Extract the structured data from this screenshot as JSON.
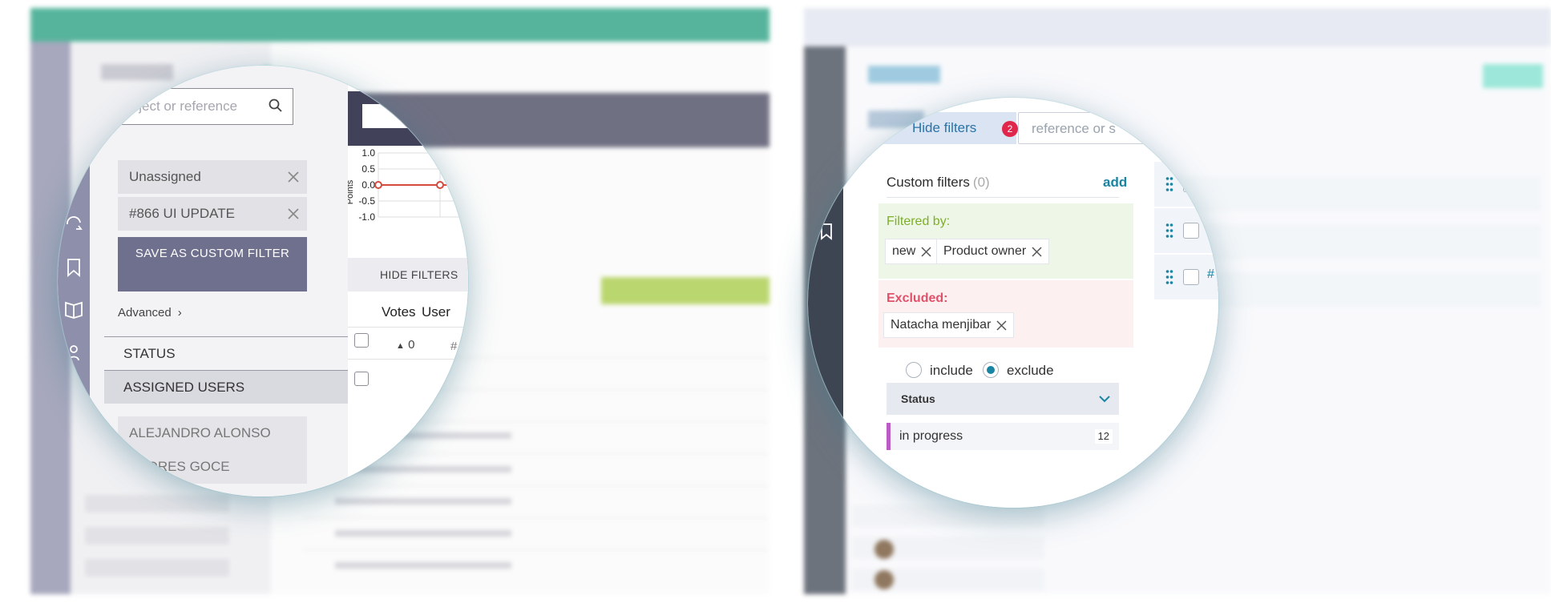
{
  "left_view": {
    "filters": {
      "search_placeholder": "Subject or reference",
      "applied": [
        "Unassigned",
        "#866 UI UPDATE"
      ],
      "save_button": "SAVE AS CUSTOM FILTER",
      "advanced": "Advanced",
      "sections": {
        "status": "STATUS",
        "assigned_users": "ASSIGNED USERS"
      },
      "users": [
        "ALEJANDRO ALONSO",
        "ANDRES GOCE"
      ]
    },
    "burndown": {
      "ylabel": "Points",
      "y_ticks": [
        "1.0",
        "0.5",
        "0.0",
        "-0.5",
        "-1.0"
      ]
    },
    "hide_filters_button": "HIDE FILTERS",
    "columns": {
      "votes": "Votes",
      "user": "User"
    },
    "rows": [
      {
        "votes": "0",
        "ref": "#"
      }
    ]
  },
  "right_view": {
    "hide_filters_button": "Hide filters",
    "filter_count": "2",
    "search_placeholder": "reference or s",
    "custom_filters": {
      "title": "Custom filters",
      "count": "(0)",
      "add_link": "add",
      "filtered_by_label": "Filtered by:",
      "filtered_by": [
        "new",
        "Product owner"
      ],
      "excluded_label": "Excluded:",
      "excluded": [
        "Natacha menjibar"
      ]
    },
    "mode": {
      "include": "include",
      "exclude": "exclude",
      "selected": "exclude"
    },
    "status_section": {
      "title": "Status",
      "items": [
        {
          "label": "in progress",
          "count": "12",
          "color": "#b85cc4"
        }
      ]
    },
    "card_ref": "#"
  },
  "colors": {
    "taiga_green": "#1f9c7c",
    "dark_band": "#41415a",
    "save_button": "#6f6f8e",
    "link_blue": "#1a84a3",
    "badge_red": "#e0264b",
    "filtered_green_text": "#7dae29",
    "excluded_red_text": "#e0526a"
  }
}
